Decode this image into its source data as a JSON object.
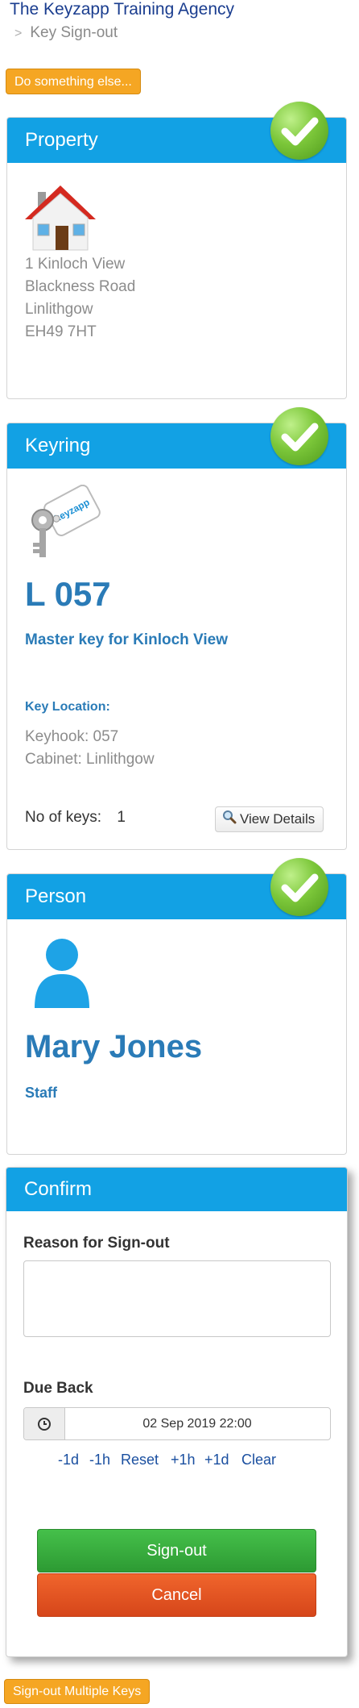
{
  "header": {
    "agency_name": "The Keyzapp Training Agency",
    "breadcrumb_sep": ">",
    "breadcrumb_current": "Key Sign-out"
  },
  "actions": {
    "do_something_else": "Do something else...",
    "sign_out_multiple": "Sign-out Multiple Keys"
  },
  "property": {
    "title": "Property",
    "address": [
      "1 Kinloch View",
      "Blackness Road",
      "Linlithgow",
      "EH49 7HT"
    ],
    "icon": "house-icon"
  },
  "keyring": {
    "title": "Keyring",
    "code": "L 057",
    "description": "Master key for Kinloch View",
    "location_label": "Key Location:",
    "keyhook": "Keyhook: 057",
    "cabinet": "Cabinet: Linlithgow",
    "keys_label": "No of keys:",
    "keys_count": "1",
    "view_details": "View Details",
    "tag_text": "keyzapp"
  },
  "person": {
    "title": "Person",
    "name": "Mary Jones",
    "role": "Staff"
  },
  "confirm": {
    "title": "Confirm",
    "reason_label": "Reason for Sign-out",
    "reason_value": "",
    "due_back_label": "Due Back",
    "due_back_value": "02 Sep 2019  22:00",
    "adjust": [
      "-1d",
      "-1h",
      "Reset",
      "+1h",
      "+1d",
      "Clear"
    ],
    "sign_out": "Sign-out",
    "cancel": "Cancel"
  },
  "colors": {
    "header_blue": "#12a1e4",
    "text_blue": "#2a7bb7",
    "orange": "#f5a623",
    "green": "#3db142",
    "red": "#e2521f"
  }
}
